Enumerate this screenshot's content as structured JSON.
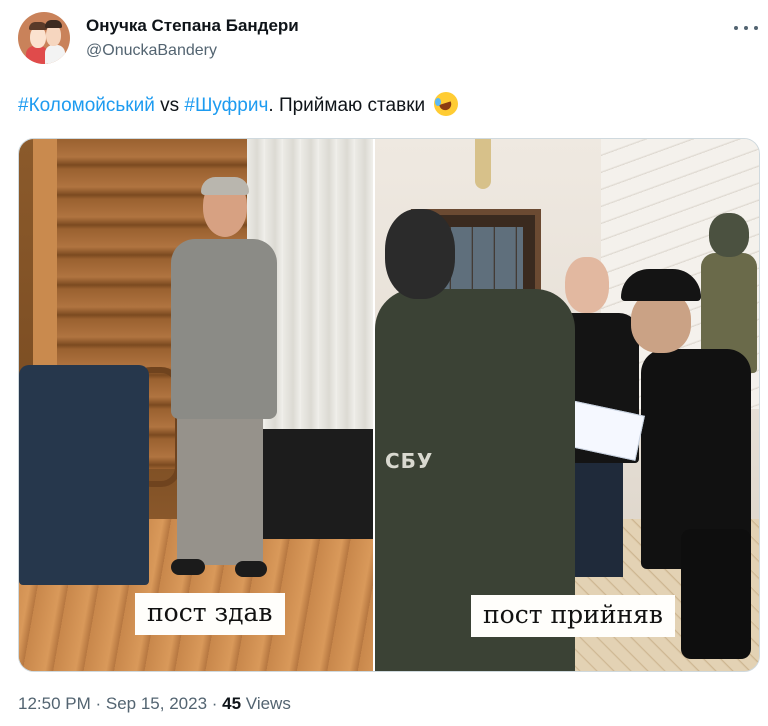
{
  "author": {
    "display_name": "Онучка Степана Бандери",
    "handle": "@OnuckaBandery",
    "avatar_icon": "avatar-illustration"
  },
  "more_icon": "more-horizontal-icon",
  "tweet": {
    "hashtag1": "#Коломойський",
    "middle": " vs ",
    "hashtag2": "#Шуфрич",
    "rest": ". Приймаю ставки",
    "emoji": "rolling-on-floor-laughing-emoji"
  },
  "media": {
    "left_caption": "пост здав",
    "right_caption": "пост прийняв",
    "patch_text": "СБУ"
  },
  "meta": {
    "time": "12:50 PM",
    "separator": " · ",
    "date": "Sep 15, 2023",
    "views_count": "45",
    "views_label": " Views"
  },
  "colors": {
    "link": "#1d9bf0",
    "text": "#0f1419",
    "muted": "#536471",
    "border": "#cfd9de"
  }
}
